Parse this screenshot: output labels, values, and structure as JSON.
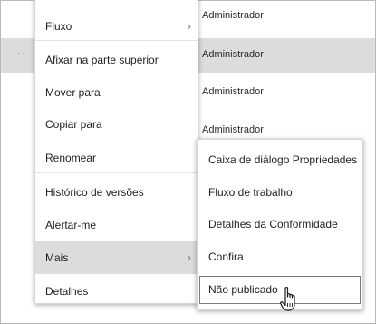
{
  "background_list": {
    "ellipsis": "···",
    "rows": [
      {
        "modified_by": "Administrador"
      },
      {
        "modified_by": "Administrador"
      },
      {
        "modified_by": "Administrador"
      },
      {
        "modified_by": "Administrador"
      }
    ]
  },
  "context_menu": {
    "items": [
      {
        "label": "Fluxo",
        "submenu": true
      },
      {
        "label": "Afixar na parte superior"
      },
      {
        "label": "Mover para"
      },
      {
        "label": "Copiar para"
      },
      {
        "label": "Renomear"
      },
      {
        "label": "Histórico de versões"
      },
      {
        "label": "Alertar-me"
      },
      {
        "label": "Mais",
        "submenu": true
      },
      {
        "label": "Detalhes"
      }
    ],
    "chevron_glyph": "›"
  },
  "submenu": {
    "items": [
      {
        "label": "Caixa de diálogo Propriedades"
      },
      {
        "label": "Fluxo de trabalho"
      },
      {
        "label": "Detalhes da Conformidade"
      },
      {
        "label": "Confira"
      },
      {
        "label": "Não publicado"
      }
    ]
  },
  "colors": {
    "hover": "#dcdcdc",
    "text": "#222222"
  }
}
